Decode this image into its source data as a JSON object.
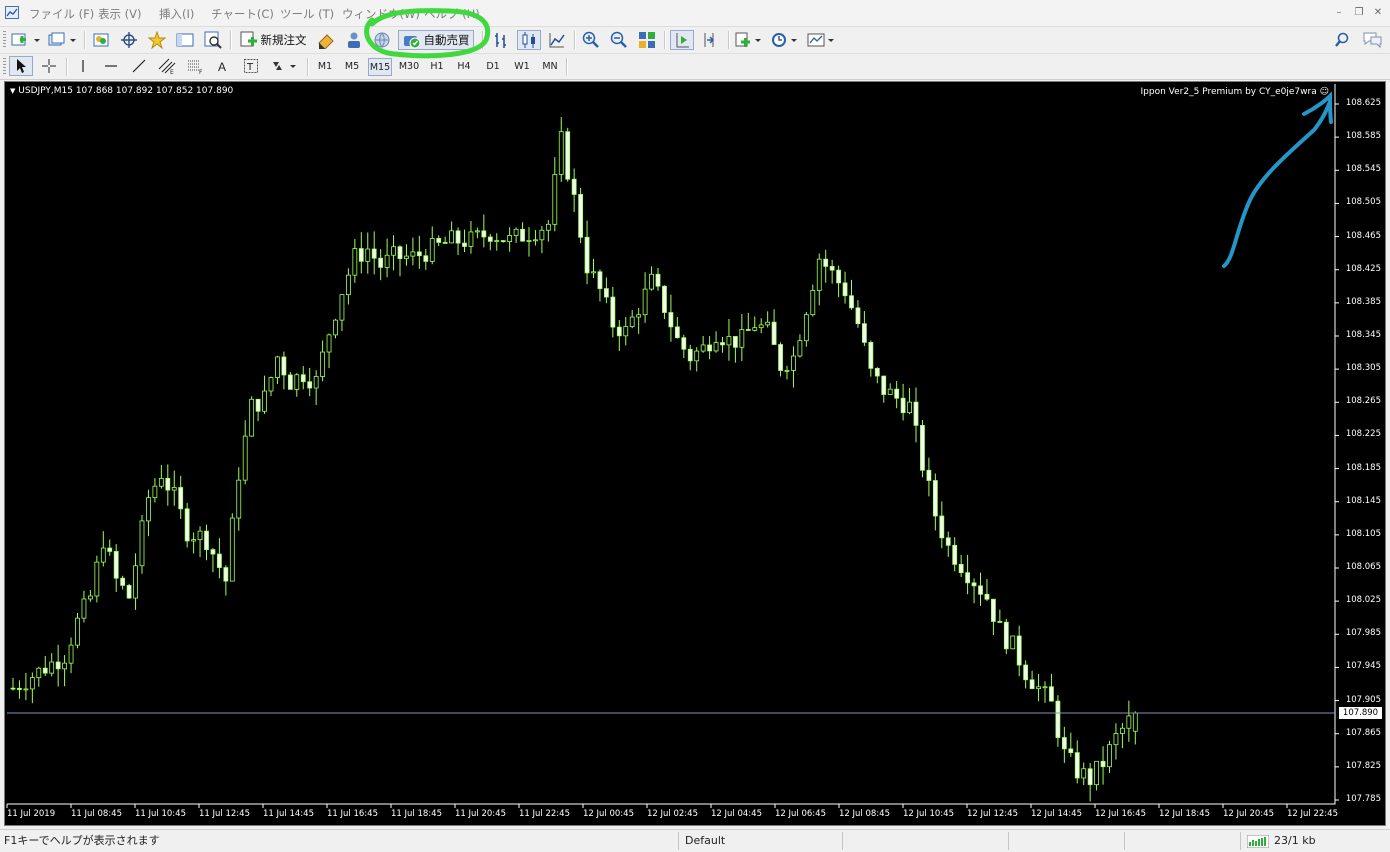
{
  "menu": {
    "items": [
      "ファイル (F)",
      "表示 (V)",
      "挿入(I)",
      "チャート(C)",
      "ツール (T)",
      "ウィンドウ(W)",
      "ヘルプ (H)"
    ]
  },
  "toolbar": {
    "new_order_label": "新規注文",
    "auto_trading_label": "自動売買"
  },
  "timeframes": [
    "M1",
    "M5",
    "M15",
    "M30",
    "H1",
    "H4",
    "D1",
    "W1",
    "MN"
  ],
  "chart": {
    "title": "USDJPY,M15  107.868 107.892 107.852 107.890",
    "expert_label": "Ippon Ver2_5 Premium by CY_e0je7wra",
    "current_price": "107.890",
    "colors": {
      "background": "#000000",
      "candle": "#9cff5a",
      "price_line": "#7f97b8"
    }
  },
  "chart_data": {
    "type": "candlestick",
    "symbol": "USDJPY",
    "timeframe": "M15",
    "y_ticks": [
      "108.625",
      "108.585",
      "108.545",
      "108.505",
      "108.465",
      "108.425",
      "108.385",
      "108.345",
      "108.305",
      "108.265",
      "108.225",
      "108.185",
      "108.145",
      "108.105",
      "108.065",
      "108.025",
      "107.985",
      "107.945",
      "107.905",
      "107.865",
      "107.825",
      "107.785"
    ],
    "x_ticks": [
      "11 Jul 2019",
      "11 Jul 08:45",
      "11 Jul 10:45",
      "11 Jul 12:45",
      "11 Jul 14:45",
      "11 Jul 16:45",
      "11 Jul 18:45",
      "11 Jul 20:45",
      "11 Jul 22:45",
      "12 Jul 00:45",
      "12 Jul 02:45",
      "12 Jul 04:45",
      "12 Jul 06:45",
      "12 Jul 08:45",
      "12 Jul 10:45",
      "12 Jul 12:45",
      "12 Jul 14:45",
      "12 Jul 16:45",
      "12 Jul 18:45",
      "12 Jul 20:45",
      "12 Jul 22:45"
    ],
    "ylim": [
      107.775,
      108.635
    ],
    "current_price": 107.89,
    "last_bar": {
      "open": 107.868,
      "high": 107.892,
      "low": 107.852,
      "close": 107.89
    },
    "close_path": [
      [
        0,
        107.92
      ],
      [
        4,
        107.94
      ],
      [
        8,
        107.96
      ],
      [
        10,
        108.0
      ],
      [
        12,
        108.03
      ],
      [
        14,
        108.1
      ],
      [
        16,
        108.05
      ],
      [
        18,
        108.03
      ],
      [
        21,
        108.15
      ],
      [
        23,
        108.18
      ],
      [
        25,
        108.15
      ],
      [
        27,
        108.11
      ],
      [
        30,
        108.1
      ],
      [
        33,
        108.05
      ],
      [
        35,
        108.18
      ],
      [
        37,
        108.26
      ],
      [
        39,
        108.27
      ],
      [
        41,
        108.32
      ],
      [
        43,
        108.29
      ],
      [
        45,
        108.3
      ],
      [
        47,
        108.29
      ],
      [
        49,
        108.35
      ],
      [
        51,
        108.4
      ],
      [
        53,
        108.44
      ],
      [
        55,
        108.45
      ],
      [
        57,
        108.43
      ],
      [
        59,
        108.44
      ],
      [
        62,
        108.44
      ],
      [
        65,
        108.45
      ],
      [
        68,
        108.46
      ],
      [
        71,
        108.46
      ],
      [
        74,
        108.47
      ],
      [
        77,
        108.46
      ],
      [
        80,
        108.47
      ],
      [
        83,
        108.48
      ],
      [
        85,
        108.58
      ],
      [
        87,
        108.51
      ],
      [
        89,
        108.43
      ],
      [
        91,
        108.4
      ],
      [
        93,
        108.36
      ],
      [
        95,
        108.35
      ],
      [
        97,
        108.38
      ],
      [
        99,
        108.41
      ],
      [
        101,
        108.38
      ],
      [
        103,
        108.34
      ],
      [
        105,
        108.32
      ],
      [
        107,
        108.33
      ],
      [
        109,
        108.35
      ],
      [
        111,
        108.34
      ],
      [
        113,
        108.34
      ],
      [
        115,
        108.36
      ],
      [
        117,
        108.35
      ],
      [
        119,
        108.31
      ],
      [
        121,
        108.32
      ],
      [
        123,
        108.38
      ],
      [
        125,
        108.44
      ],
      [
        127,
        108.42
      ],
      [
        129,
        108.4
      ],
      [
        131,
        108.36
      ],
      [
        133,
        108.3
      ],
      [
        135,
        108.28
      ],
      [
        137,
        108.27
      ],
      [
        139,
        108.26
      ],
      [
        141,
        108.19
      ],
      [
        143,
        108.13
      ],
      [
        145,
        108.09
      ],
      [
        147,
        108.07
      ],
      [
        149,
        108.05
      ],
      [
        151,
        108.03
      ],
      [
        153,
        107.99
      ],
      [
        155,
        107.97
      ],
      [
        157,
        107.94
      ],
      [
        159,
        107.92
      ],
      [
        161,
        107.9
      ],
      [
        163,
        107.84
      ],
      [
        165,
        107.82
      ],
      [
        167,
        107.81
      ],
      [
        169,
        107.83
      ],
      [
        171,
        107.86
      ],
      [
        173,
        107.88
      ],
      [
        174,
        107.89
      ]
    ]
  },
  "status": {
    "help": "F1キーでヘルプが表示されます",
    "profile": "Default",
    "traffic": "23/1 kb"
  }
}
